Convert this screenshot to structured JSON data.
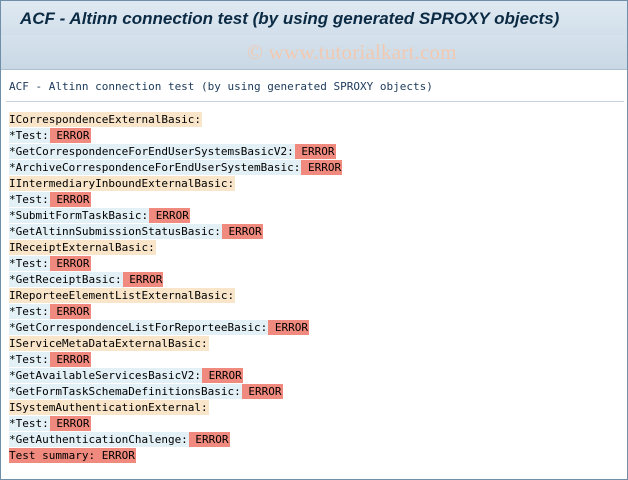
{
  "window": {
    "title": "ACF - Altinn connection test (by using generated SPROXY objects)",
    "watermark": "© www.tutorialkart.com"
  },
  "list": {
    "header": "ACF - Altinn connection test (by using generated SPROXY objects)",
    "lines": [
      {
        "text": "ICorrespondenceExternalBasic:",
        "status": ""
      },
      {
        "text": "*Test:",
        "status": "ERROR"
      },
      {
        "text": "*GetCorrespondenceForEndUserSystemsBasicV2:",
        "status": "ERROR"
      },
      {
        "text": "*ArchiveCorrespondenceForEndUserSystemBasic:",
        "status": "ERROR"
      },
      {
        "text": "IIntermediaryInboundExternalBasic:",
        "status": ""
      },
      {
        "text": "*Test:",
        "status": "ERROR"
      },
      {
        "text": "*SubmitFormTaskBasic:",
        "status": "ERROR"
      },
      {
        "text": "*GetAltinnSubmissionStatusBasic:",
        "status": "ERROR"
      },
      {
        "text": "IReceiptExternalBasic:",
        "status": ""
      },
      {
        "text": "*Test:",
        "status": "ERROR"
      },
      {
        "text": "*GetReceiptBasic:",
        "status": "ERROR"
      },
      {
        "text": "IReporteeElementListExternalBasic:",
        "status": ""
      },
      {
        "text": "*Test:",
        "status": "ERROR"
      },
      {
        "text": "*GetCorrespondenceListForReporteeBasic:",
        "status": "ERROR"
      },
      {
        "text": "IServiceMetaDataExternalBasic:",
        "status": ""
      },
      {
        "text": "*Test:",
        "status": "ERROR"
      },
      {
        "text": "*GetAvailableServicesBasicV2:",
        "status": "ERROR"
      },
      {
        "text": "*GetFormTaskSchemaDefinitionsBasic:",
        "status": "ERROR"
      },
      {
        "text": "ISystemAuthenticationExternal:",
        "status": ""
      },
      {
        "text": "*Test:",
        "status": "ERROR"
      },
      {
        "text": "*GetAuthenticationChalenge:",
        "status": "ERROR"
      }
    ],
    "summary": "Test summary: ERROR"
  }
}
